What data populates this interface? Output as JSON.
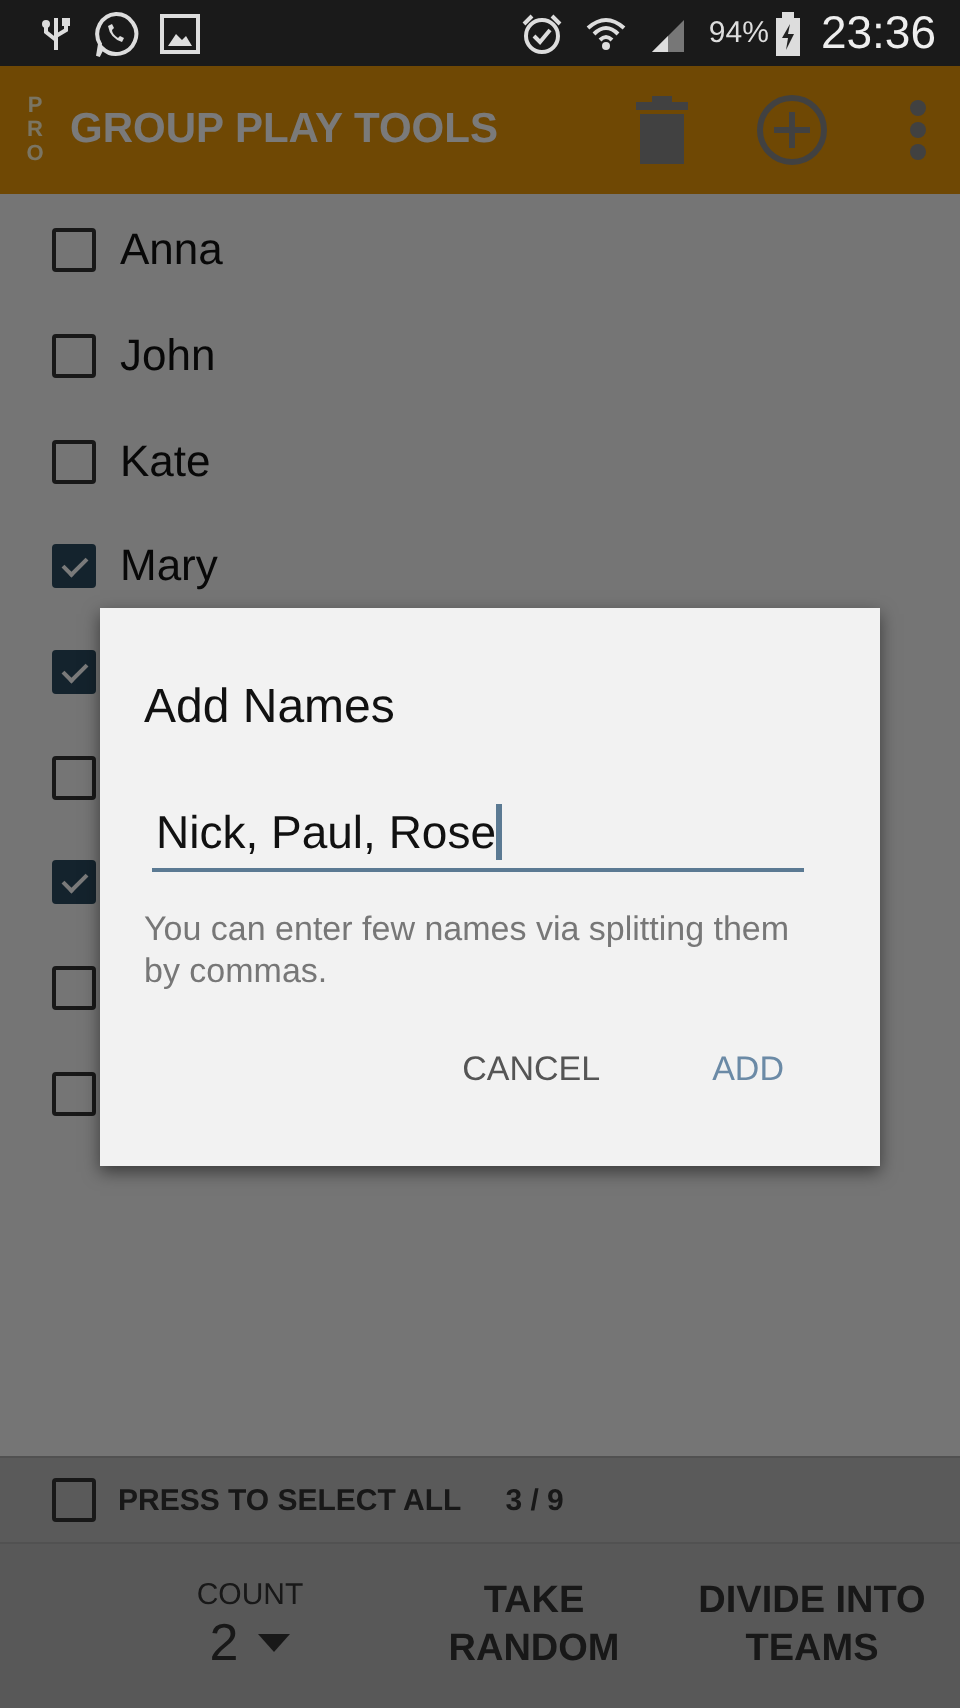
{
  "status_bar": {
    "battery": "94%",
    "time": "23:36"
  },
  "app_bar": {
    "badge": "PRO",
    "title": "GROUP PLAY TOOLS"
  },
  "names": [
    {
      "name": "Anna",
      "checked": false
    },
    {
      "name": "John",
      "checked": false
    },
    {
      "name": "Kate",
      "checked": false
    },
    {
      "name": "Mary",
      "checked": true
    },
    {
      "checked": true
    },
    {
      "checked": false
    },
    {
      "checked": true
    },
    {
      "checked": false
    },
    {
      "checked": false
    }
  ],
  "select_all": {
    "label": "PRESS TO SELECT ALL",
    "checked": false,
    "counter": "3 / 9"
  },
  "bottom_bar": {
    "count_label": "COUNT",
    "count_value": "2",
    "buttons": [
      "TAKE RANDOM",
      "DIVIDE INTO TEAMS"
    ]
  },
  "dialog": {
    "title": "Add Names",
    "value": "Nick, Paul, Rose",
    "helper": "You can enter few names via splitting them by commas.",
    "buttons": [
      {
        "label": "CANCEL",
        "kind": "cancel"
      },
      {
        "label": "ADD",
        "kind": "confirm"
      }
    ]
  }
}
